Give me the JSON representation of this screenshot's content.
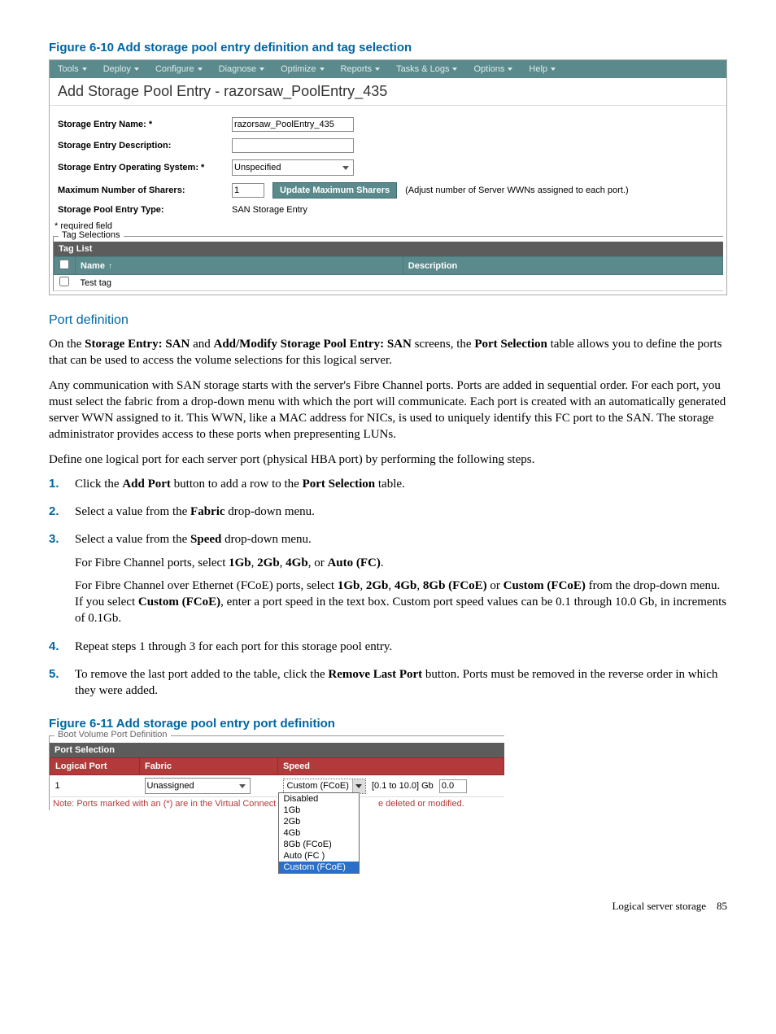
{
  "figure1": {
    "title": "Figure 6-10 Add storage pool entry definition and tag selection"
  },
  "toolbar": {
    "items": [
      "Tools",
      "Deploy",
      "Configure",
      "Diagnose",
      "Optimize",
      "Reports",
      "Tasks & Logs",
      "Options",
      "Help"
    ]
  },
  "appHeader": "Add Storage Pool Entry - razorsaw_PoolEntry_435",
  "form": {
    "l_name": "Storage Entry Name: *",
    "v_name": "razorsaw_PoolEntry_435",
    "l_desc": "Storage Entry Description:",
    "v_desc": "",
    "l_os": "Storage Entry Operating System: *",
    "v_os": "Unspecified",
    "l_sharers": "Maximum Number of Sharers:",
    "v_sharers": "1",
    "btn_update": "Update Maximum Sharers",
    "hint": "(Adjust number of Server WWNs assigned to each port.)",
    "l_type": "Storage Pool Entry Type:",
    "v_type": "SAN Storage Entry",
    "required": "* required field"
  },
  "tagbox": {
    "legend": "Tag Selections",
    "header": "Tag List",
    "col_name": "Name",
    "col_desc": "Description",
    "row0": "Test tag"
  },
  "section": {
    "title": "Port definition"
  },
  "para1a": "On the ",
  "para1b": "Storage Entry: SAN",
  "para1c": " and ",
  "para1d": "Add/Modify Storage Pool Entry: SAN",
  "para1e": " screens, the ",
  "para1f": "Port Selection",
  "para1g": " table allows you to define the ports that can be used to access the volume selections for this logical server.",
  "para2": "Any communication with SAN storage starts with the server's Fibre Channel ports. Ports are added in sequential order. For each port, you must select the fabric from a drop-down menu with which the port will communicate. Each port is created with an automatically generated server WWN assigned to it. This WWN, like a MAC address for NICs, is used to uniquely identify this FC port to the SAN. The storage administrator provides access to these ports when prepresenting LUNs.",
  "para3": "Define one logical port for each server port (physical HBA port) by performing the following steps.",
  "steps": {
    "n1": "1.",
    "s1a": "Click the ",
    "s1b": "Add Port",
    "s1c": " button to add a row to the ",
    "s1d": "Port Selection",
    "s1e": " table.",
    "n2": "2.",
    "s2a": "Select a value from the ",
    "s2b": "Fabric",
    "s2c": " drop-down menu.",
    "n3": "3.",
    "s3a": "Select a value from the ",
    "s3b": "Speed",
    "s3c": " drop-down menu.",
    "s3p2a": "For Fibre Channel ports, select ",
    "s3p2b": "1Gb",
    "s3p2c": ", ",
    "s3p2d": "2Gb",
    "s3p2e": ", ",
    "s3p2f": "4Gb",
    "s3p2g": ", or ",
    "s3p2h": "Auto (FC)",
    "s3p2i": ".",
    "s3p3a": "For Fibre Channel over Ethernet (FCoE) ports, select ",
    "s3p3b": "1Gb",
    "s3p3c": ", ",
    "s3p3d": "2Gb",
    "s3p3e": ", ",
    "s3p3f": "4Gb",
    "s3p3g": ", ",
    "s3p3h": "8Gb (FCoE)",
    "s3p3i": " or ",
    "s3p3j": "Custom (FCoE)",
    "s3p3k": " from the drop-down menu. If you select ",
    "s3p3l": "Custom (FCoE)",
    "s3p3m": ", enter a port speed in the text box. Custom port speed values can be 0.1 through 10.0 Gb, in increments of 0.1Gb.",
    "n4": "4.",
    "s4": "Repeat steps 1 through 3 for each port for this storage pool entry.",
    "n5": "5.",
    "s5a": "To remove the last port added to the table, click the ",
    "s5b": "Remove Last Port",
    "s5c": " button. Ports must be removed in the reverse order in which they were added."
  },
  "figure2": {
    "title": "Figure 6-11 Add storage pool entry port definition"
  },
  "portframe": {
    "legend": "Boot Volume Port Definition",
    "subhead": "Port Selection",
    "col1": "Logical Port",
    "col2": "Fabric",
    "col3": "Speed",
    "row_port": "1",
    "row_fabric": "Unassigned",
    "row_speed_sel": "Custom (FCoE)",
    "row_speed_range": "[0.1 to 10.0] Gb",
    "row_speed_val": "0.0",
    "note_left": "Note: Ports marked with an (*) are in the Virtual Connect",
    "note_right": "e deleted or modified.",
    "dd": [
      "Disabled",
      "1Gb",
      "2Gb",
      "4Gb",
      "8Gb (FCoE)",
      "Auto (FC )",
      "Custom (FCoE)"
    ]
  },
  "footer": {
    "text": "Logical server storage",
    "page": "85"
  }
}
